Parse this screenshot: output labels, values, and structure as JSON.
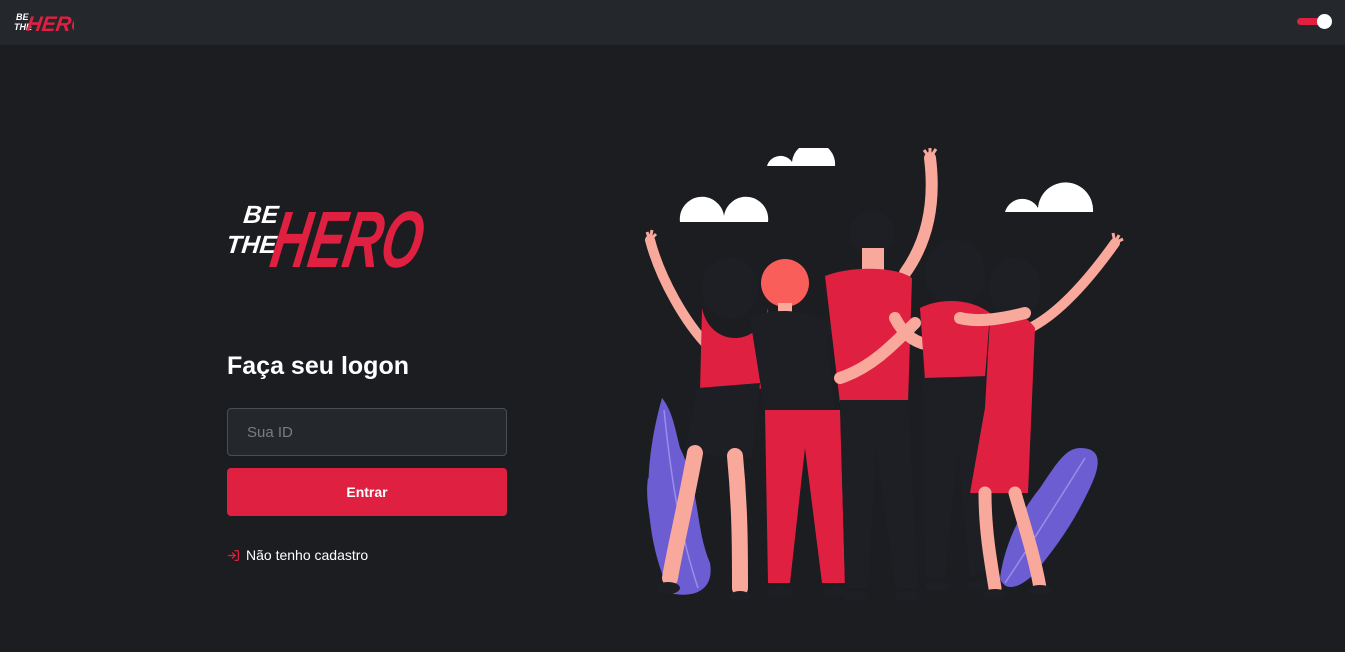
{
  "header": {
    "logo_line1": "BE",
    "logo_line2": "THE",
    "logo_word": "HERO",
    "theme_toggle_state": "on"
  },
  "logo": {
    "line1": "BE",
    "line2": "THE",
    "word": "HERO"
  },
  "login": {
    "title": "Faça seu logon",
    "id_placeholder": "Sua ID",
    "id_value": "",
    "submit_label": "Entrar",
    "register_label": "Não tenho cadastro",
    "register_icon": "log-in-icon"
  },
  "illustration": {
    "name": "heroes-group-illustration"
  },
  "colors": {
    "accent": "#e02041",
    "background": "#1c1d21",
    "topbar": "#24272b",
    "leaf": "#6c5dd3",
    "skin": "#f9a89c",
    "dark": "#1e1f24"
  }
}
